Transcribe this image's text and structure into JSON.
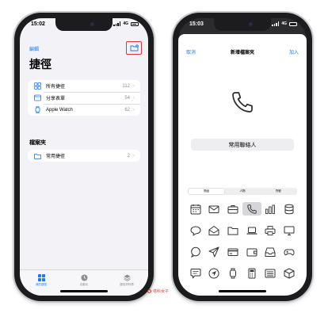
{
  "left": {
    "status_time": "15:02",
    "network": "4G",
    "edit_label": "編輯",
    "title": "捷徑",
    "rows": [
      {
        "label": "所有捷徑",
        "count": "112",
        "icon": "grid-icon"
      },
      {
        "label": "分享表單",
        "count": "54",
        "icon": "share-sheet-icon"
      },
      {
        "label": "Apple Watch",
        "count": "62",
        "icon": "watch-icon"
      }
    ],
    "folders_header": "檔案夾",
    "folders": [
      {
        "label": "常用捷徑",
        "count": "2",
        "icon": "folder-icon"
      }
    ],
    "tabs": [
      {
        "label": "我的捷徑",
        "active": true
      },
      {
        "label": "自動化",
        "active": false
      },
      {
        "label": "捷徑資料庫",
        "active": false
      }
    ]
  },
  "right": {
    "status_time": "15:03",
    "network": "4G",
    "cancel_label": "取消",
    "sheet_title": "新增檔案夾",
    "add_label": "加入",
    "folder_name": "常用聯絡人",
    "segments": [
      {
        "label": "物品",
        "selected": true
      },
      {
        "label": "人物",
        "selected": false
      },
      {
        "label": "符號",
        "selected": false
      }
    ],
    "icon_grid": [
      "calendar-icon",
      "envelope-icon",
      "briefcase-icon",
      "phone-icon",
      "bar-chart-icon",
      "database-icon",
      "speech-bubble-icon",
      "open-envelope-icon",
      "folder-icon",
      "laptop-icon",
      "printer-icon",
      "desktop-icon",
      "chat-bubble-icon",
      "paper-plane-icon",
      "credit-card-icon",
      "wallet-icon",
      "tray-icon",
      "gamepad-icon",
      "message-icon",
      "location-arrow-icon",
      "watch-icon",
      "calculator-icon",
      "list-icon",
      "cube-icon"
    ],
    "selected_icon": "phone-icon"
  },
  "watermark": "塔科女子",
  "colors": {
    "accent": "#1a7aff",
    "highlight": "#e8322d"
  }
}
